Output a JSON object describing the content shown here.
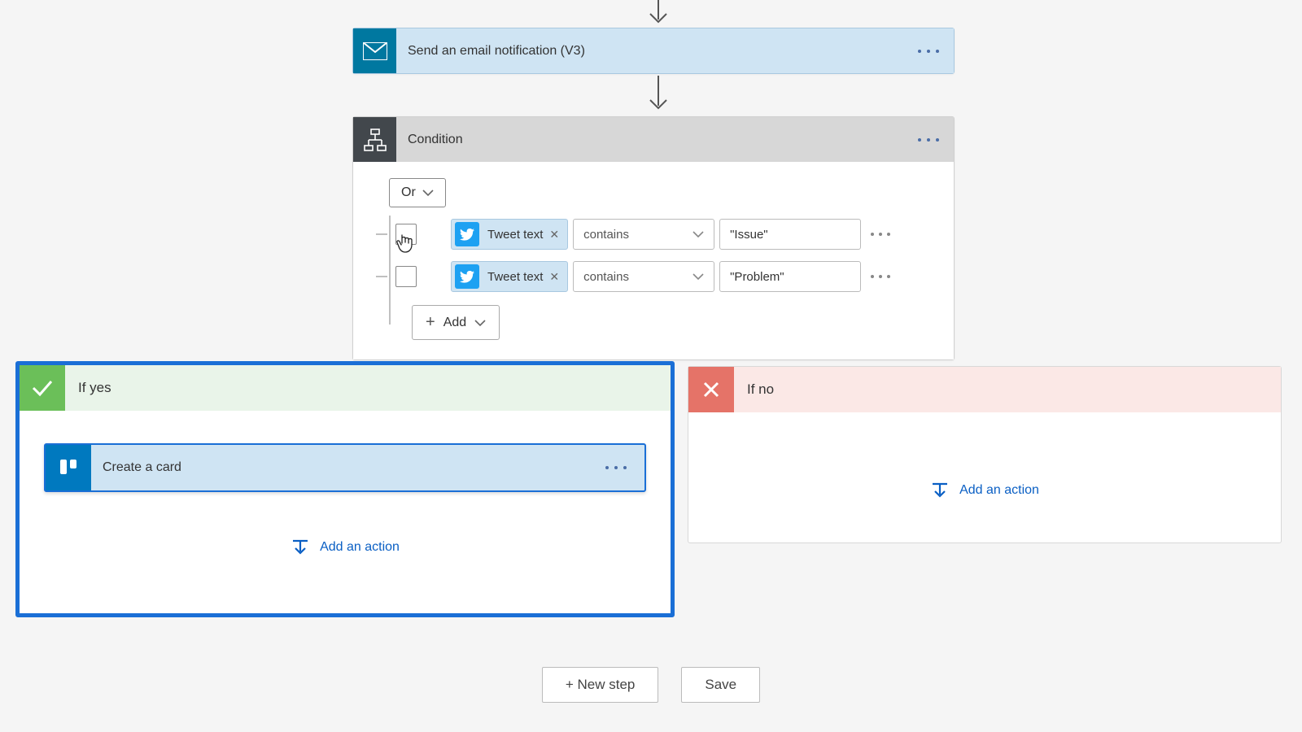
{
  "email_step": {
    "title": "Send an email notification (V3)"
  },
  "condition": {
    "title": "Condition",
    "logic": "Or",
    "add_label": "Add",
    "rows": [
      {
        "pill": "Tweet text",
        "op": "contains",
        "value": "\"Issue\""
      },
      {
        "pill": "Tweet text",
        "op": "contains",
        "value": "\"Problem\""
      }
    ]
  },
  "branches": {
    "yes": {
      "title": "If yes",
      "action_title": "Create a card",
      "add_action_label": "Add an action"
    },
    "no": {
      "title": "If no",
      "add_action_label": "Add an action"
    }
  },
  "footer": {
    "new_step": "+ New step",
    "save": "Save"
  }
}
